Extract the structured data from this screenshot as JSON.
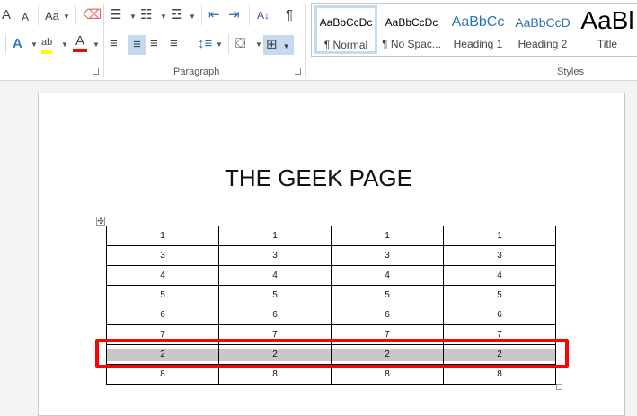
{
  "ribbon": {
    "font_group": {
      "grow_font": "A",
      "shrink_font": "A",
      "change_case": "Aa",
      "text_effects": "A",
      "highlight": "ab",
      "font_color": "A",
      "highlight_color": "#ffff00",
      "font_color_value": "#ff0000"
    },
    "paragraph_group": {
      "label": "Paragraph",
      "sort": "A↓",
      "pilcrow": "¶"
    },
    "styles_group": {
      "label": "Styles",
      "items": [
        {
          "preview": "AaBbCcDc",
          "name": "¶ Normal"
        },
        {
          "preview": "AaBbCcDc",
          "name": "¶ No Spac..."
        },
        {
          "preview": "AaBbCc",
          "name": "Heading 1"
        },
        {
          "preview": "AaBbCcD",
          "name": "Heading 2"
        },
        {
          "preview": "AaBl",
          "name": "Title"
        }
      ]
    }
  },
  "document": {
    "title": "THE GEEK PAGE",
    "table": [
      [
        "1",
        "1",
        "1",
        "1"
      ],
      [
        "3",
        "3",
        "3",
        "3"
      ],
      [
        "4",
        "4",
        "4",
        "4"
      ],
      [
        "5",
        "5",
        "5",
        "5"
      ],
      [
        "6",
        "6",
        "6",
        "6"
      ],
      [
        "7",
        "7",
        "7",
        "7"
      ],
      [
        "2",
        "2",
        "2",
        "2"
      ],
      [
        "8",
        "8",
        "8",
        "8"
      ]
    ],
    "highlighted_row_index": 6,
    "highlight_color": "#ff0000"
  }
}
